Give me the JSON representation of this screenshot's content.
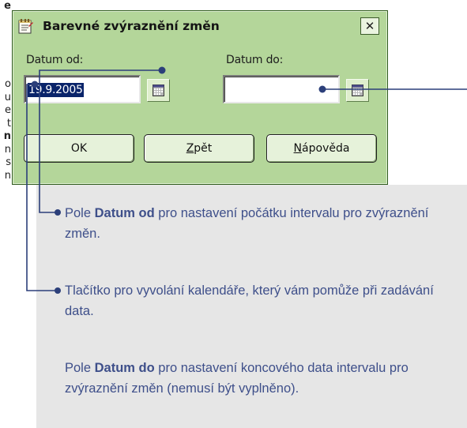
{
  "edge_text": [
    {
      "text": "e",
      "bold": true
    },
    {
      "text": "",
      "bold": false
    },
    {
      "text": "",
      "bold": false
    },
    {
      "text": "",
      "bold": false
    },
    {
      "text": "",
      "bold": false
    },
    {
      "text": "",
      "bold": false
    },
    {
      "text": "o",
      "bold": false
    },
    {
      "text": "u",
      "bold": false
    },
    {
      "text": "e",
      "bold": false
    },
    {
      "text": "t",
      "bold": false
    },
    {
      "text": "n",
      "bold": true
    },
    {
      "text": "n",
      "bold": false
    },
    {
      "text": "s",
      "bold": false
    },
    {
      "text": "n",
      "bold": false
    }
  ],
  "dialog": {
    "title": "Barevné zvýraznění změn",
    "close_glyph": "✕",
    "date_from_label": "Datum od:",
    "date_from_value": "19.9.2005",
    "date_to_label": "Datum do:",
    "date_to_value": "",
    "buttons": {
      "ok": "OK",
      "back_mnemonic": "Z",
      "back_rest": "pět",
      "help_mnemonic": "N",
      "help_rest": "ápověda"
    }
  },
  "callouts": {
    "c1_pre": "Pole ",
    "c1_bold": "Datum od",
    "c1_post": " pro nastavení počátku intervalu pro zvýraznění změn.",
    "c2": "Tlačítko pro vyvolání kalendáře, který vám pomůže při zadávání data.",
    "c3_pre": "Pole ",
    "c3_bold": "Datum do",
    "c3_post": " pro nastavení koncového data intervalu pro zvýraznění změn (nemusí být vyplněno)."
  },
  "colors": {
    "dialog_bg": "#b4d69a",
    "callout_text": "#3e4f8a",
    "connector": "#2c3f7a",
    "panel_bg": "#e6e6e6",
    "selection": "#0a246a"
  }
}
